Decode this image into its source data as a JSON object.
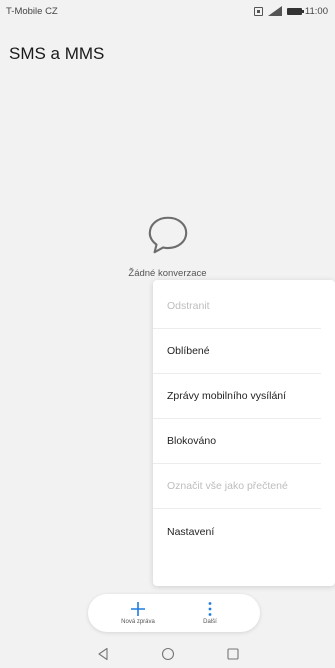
{
  "status_bar": {
    "carrier": "T-Mobile CZ",
    "time": "11:00",
    "icons": [
      "sim-icon",
      "signal-icon",
      "battery-icon"
    ]
  },
  "header": {
    "title": "SMS a MMS"
  },
  "empty_state": {
    "icon": "chat-bubble-icon",
    "text": "Žádné konverzace"
  },
  "menu": {
    "items": [
      {
        "label": "Odstranit",
        "enabled": false
      },
      {
        "label": "Oblíbené",
        "enabled": true
      },
      {
        "label": "Zprávy mobilního vysílání",
        "enabled": true
      },
      {
        "label": "Blokováno",
        "enabled": true
      },
      {
        "label": "Označit vše jako přečtené",
        "enabled": false
      },
      {
        "label": "Nastavení",
        "enabled": true
      }
    ]
  },
  "bottom_bar": {
    "new_message_label": "Nová zpráva",
    "more_label": "Další",
    "accent_color": "#1e7be0"
  },
  "nav_bar": {
    "icons": [
      "back-icon",
      "home-icon",
      "recents-icon"
    ]
  }
}
